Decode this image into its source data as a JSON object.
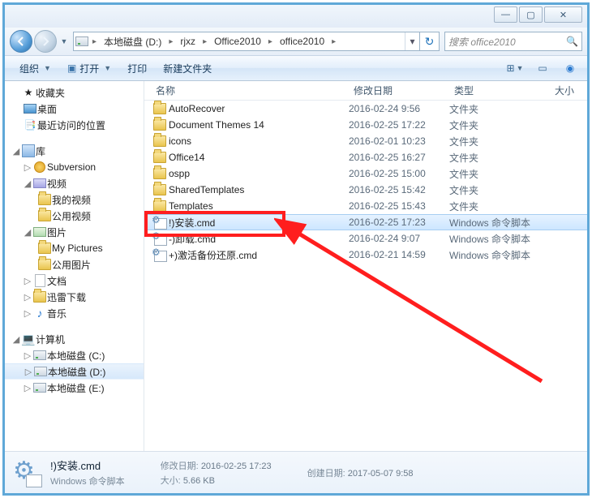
{
  "window": {
    "min": "—",
    "max": "▢",
    "close": "✕"
  },
  "path": {
    "segments": [
      "本地磁盘 (D:)",
      "rjxz",
      "Office2010",
      "office2010"
    ]
  },
  "search": {
    "placeholder": "搜索 office2010"
  },
  "toolbar": {
    "organize": "组织",
    "open": "打开",
    "print": "打印",
    "newfolder": "新建文件夹"
  },
  "tree": {
    "favorites": "收藏夹",
    "desktop": "桌面",
    "recent": "最近访问的位置",
    "libraries": "库",
    "subversion": "Subversion",
    "videos": "视频",
    "my_videos": "我的视频",
    "public_videos": "公用视频",
    "pictures": "图片",
    "my_pictures": "My Pictures",
    "public_pictures": "公用图片",
    "documents": "文档",
    "downloads": "迅雷下载",
    "music": "音乐",
    "computer": "计算机",
    "drive_c": "本地磁盘 (C:)",
    "drive_d": "本地磁盘 (D:)",
    "drive_e": "本地磁盘 (E:)"
  },
  "columns": {
    "name": "名称",
    "date": "修改日期",
    "type": "类型",
    "size": "大小"
  },
  "files": [
    {
      "name": "AutoRecover",
      "date": "2016-02-24 9:56",
      "type": "文件夹",
      "kind": "folder"
    },
    {
      "name": "Document Themes 14",
      "date": "2016-02-25 17:22",
      "type": "文件夹",
      "kind": "folder"
    },
    {
      "name": "icons",
      "date": "2016-02-01 10:23",
      "type": "文件夹",
      "kind": "folder"
    },
    {
      "name": "Office14",
      "date": "2016-02-25 16:27",
      "type": "文件夹",
      "kind": "folder"
    },
    {
      "name": "ospp",
      "date": "2016-02-25 15:00",
      "type": "文件夹",
      "kind": "folder"
    },
    {
      "name": "SharedTemplates",
      "date": "2016-02-25 15:42",
      "type": "文件夹",
      "kind": "folder"
    },
    {
      "name": "Templates",
      "date": "2016-02-25 15:43",
      "type": "文件夹",
      "kind": "folder"
    },
    {
      "name": "!)安装.cmd",
      "date": "2016-02-25 17:23",
      "type": "Windows 命令脚本",
      "kind": "cmd",
      "selected": true
    },
    {
      "name": "-)卸载.cmd",
      "date": "2016-02-24 9:07",
      "type": "Windows 命令脚本",
      "kind": "cmd"
    },
    {
      "name": "+)激活备份还原.cmd",
      "date": "2016-02-21 14:59",
      "type": "Windows 命令脚本",
      "kind": "cmd"
    }
  ],
  "details": {
    "filename": "!)安装.cmd",
    "filetype": "Windows 命令脚本",
    "mod_label": "修改日期:",
    "mod_value": "2016-02-25 17:23",
    "size_label": "大小:",
    "size_value": "5.66 KB",
    "created_label": "创建日期:",
    "created_value": "2017-05-07 9:58"
  }
}
